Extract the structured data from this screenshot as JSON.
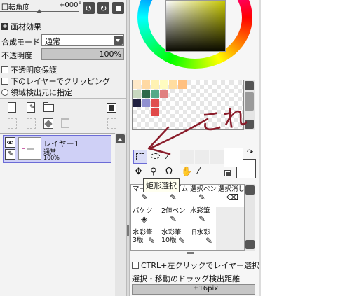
{
  "rotation": {
    "label": "回転角度",
    "value": "+000°"
  },
  "material_effect": {
    "label": "画材効果"
  },
  "blend_mode": {
    "label": "合成モード",
    "value": "通常"
  },
  "opacity": {
    "label": "不透明度",
    "value": "100%",
    "fraction": 1.0
  },
  "checkboxes": [
    {
      "label": "不透明度保護"
    },
    {
      "label": "下のレイヤーでクリッピング"
    }
  ],
  "radio": {
    "label": "領域検出元に指定"
  },
  "layer": {
    "name": "レイヤー1",
    "mode": "通常",
    "opacity": "100%"
  },
  "annotation": {
    "text": "これ",
    "color": "#8a1c2a"
  },
  "tooltip": {
    "text": "矩形選択"
  },
  "tools": [
    {
      "label": "マーカー"
    },
    {
      "label": "消しゴム"
    },
    {
      "label": "選択ペン"
    },
    {
      "label": "選択消し"
    },
    {
      "label": "バケツ"
    },
    {
      "label": "2値ペン"
    },
    {
      "label": "水彩筆"
    },
    {
      "label": "水彩筆\n3版"
    },
    {
      "label": "水彩筆\n10版"
    },
    {
      "label": "旧水彩"
    }
  ],
  "ctrl_option": {
    "label": "CTRL+左クリックでレイヤー選択"
  },
  "drag_distance": {
    "label": "選択・移動のドラッグ検出距離",
    "value": "±16pix"
  },
  "palette_colors": [
    "#ffe9c8",
    "#ffd9a3",
    "#fff2b3",
    "#fffcc0",
    "#ffdda0",
    "#ffc080",
    "#c8d8c0",
    "#2e6a4a",
    "#55aa88",
    "#e08080",
    "#202040",
    "#9090d0",
    "#e05050",
    "#e04848"
  ]
}
